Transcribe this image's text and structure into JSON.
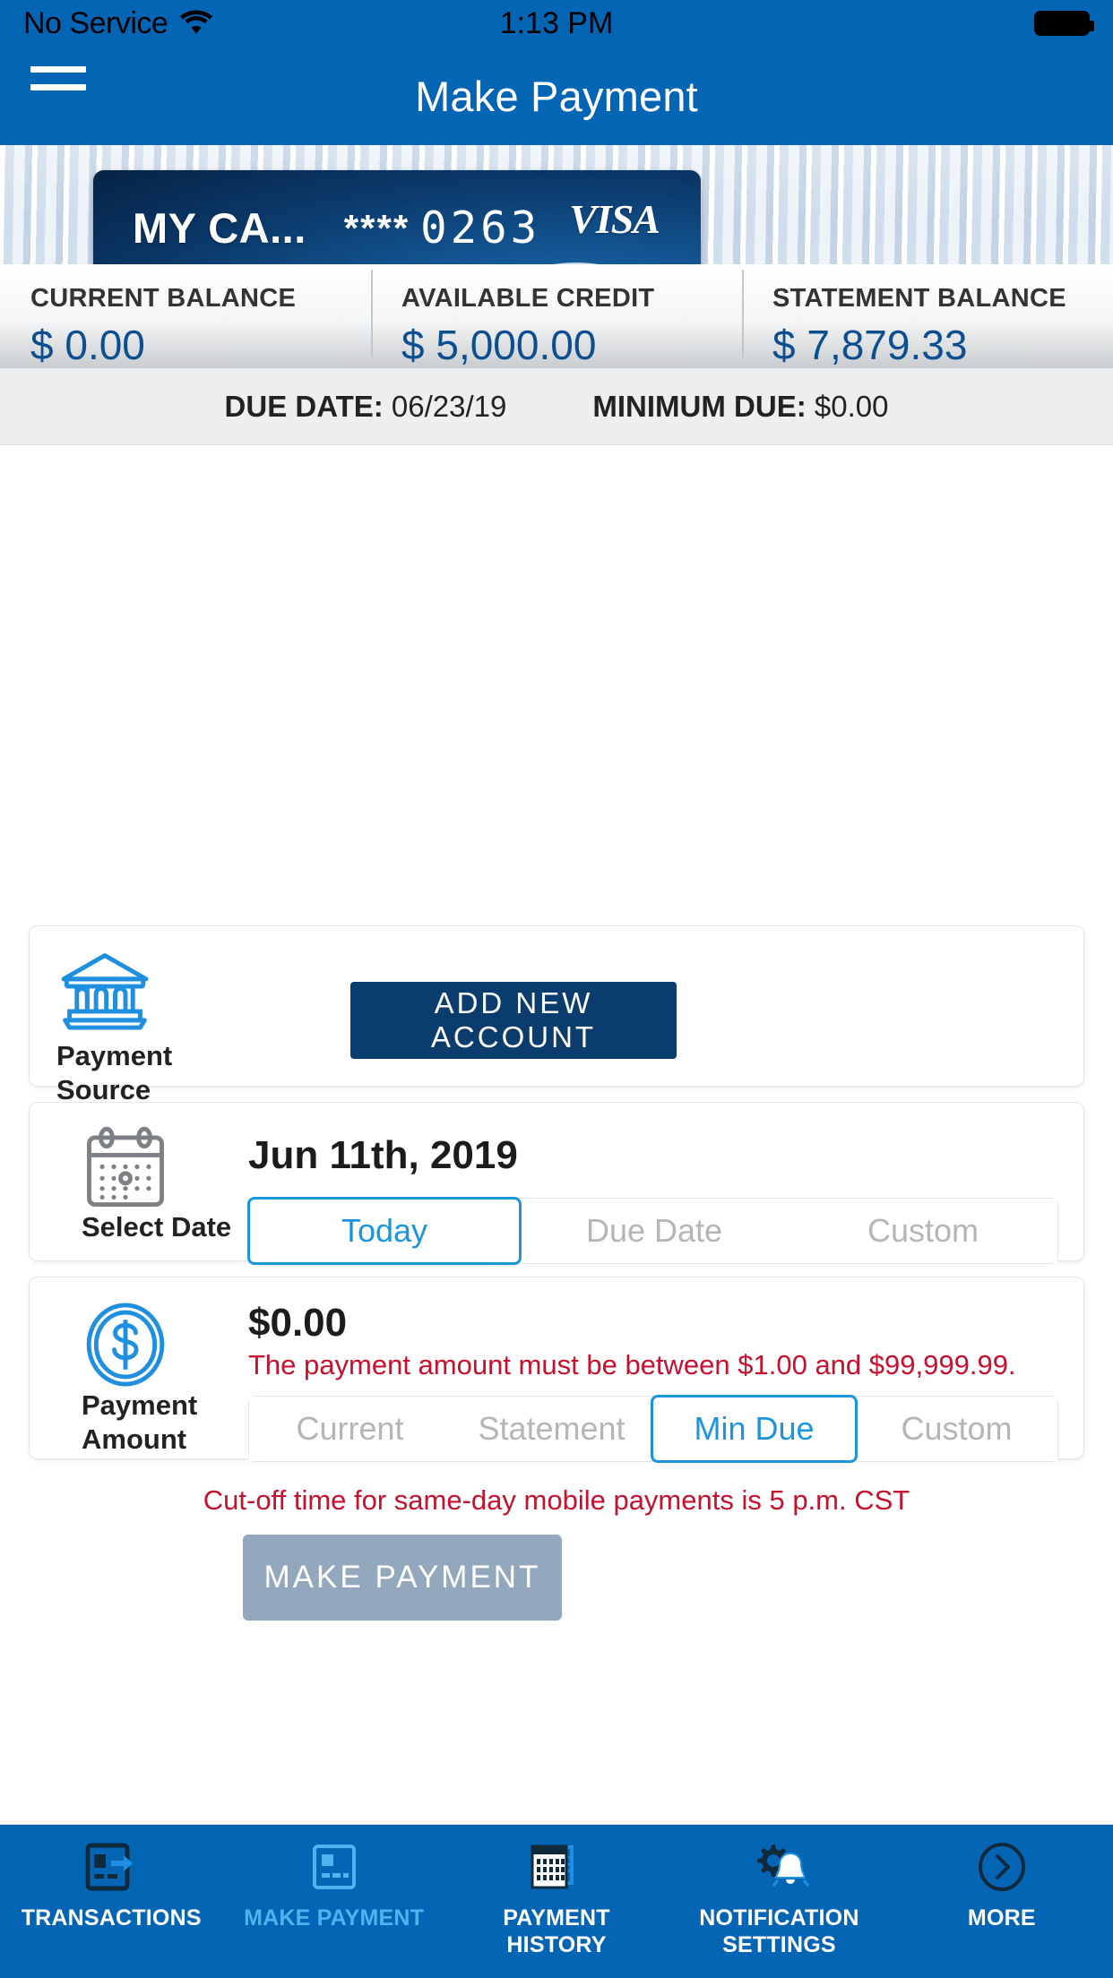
{
  "status_bar": {
    "carrier": "No Service",
    "wifi_icon": "wifi-icon",
    "time": "1:13 PM",
    "battery_icon": "battery-full-icon"
  },
  "nav": {
    "menu_icon": "hamburger-menu-icon",
    "title": "Make Payment"
  },
  "card": {
    "name": "MY CA...",
    "mask": "****",
    "last4": "0263",
    "network": "VISA"
  },
  "balances": [
    {
      "label": "CURRENT BALANCE",
      "value": "$ 0.00"
    },
    {
      "label": "AVAILABLE CREDIT",
      "value": "$ 5,000.00"
    },
    {
      "label": "STATEMENT BALANCE",
      "value": "$ 7,879.33"
    }
  ],
  "due_row": {
    "due_date_label": "DUE DATE:",
    "due_date_value": "06/23/19",
    "minimum_due_label": "MINIMUM DUE:",
    "minimum_due_value": "$0.00"
  },
  "payment_source": {
    "icon": "bank-icon",
    "label": "Payment\nSource",
    "label_line1": "Payment",
    "label_line2": "Source",
    "add_account_button": "ADD NEW ACCOUNT"
  },
  "select_date": {
    "icon": "calendar-icon",
    "label": "Select Date",
    "date_value": "Jun 11th, 2019",
    "options": [
      {
        "label": "Today",
        "selected": true
      },
      {
        "label": "Due Date",
        "selected": false
      },
      {
        "label": "Custom",
        "selected": false
      }
    ]
  },
  "payment_amount": {
    "icon": "dollar-coin-icon",
    "label_line1": "Payment",
    "label_line2": "Amount",
    "amount_value": "$0.00",
    "error_message": "The payment amount must be between $1.00 and $99,999.99.",
    "options": [
      {
        "label": "Current",
        "selected": false
      },
      {
        "label": "Statement",
        "selected": false
      },
      {
        "label": "Min Due",
        "selected": true
      },
      {
        "label": "Custom",
        "selected": false
      }
    ]
  },
  "cutoff_notice": "Cut-off time for same-day mobile payments is 5 p.m. CST",
  "make_payment_button": "MAKE PAYMENT",
  "tab_bar": [
    {
      "icon": "transactions-card-arrow-icon",
      "label_line1": "TRANSACTIONS",
      "label_line2": "",
      "active": false
    },
    {
      "icon": "make-payment-card-icon",
      "label_line1": "MAKE PAYMENT",
      "label_line2": "",
      "active": true
    },
    {
      "icon": "payment-history-calendar-dollar-icon",
      "label_line1": "PAYMENT",
      "label_line2": "HISTORY",
      "active": false
    },
    {
      "icon": "notification-settings-gear-bell-icon",
      "label_line1": "NOTIFICATION",
      "label_line2": "SETTINGS",
      "active": false
    },
    {
      "icon": "more-chevron-circle-icon",
      "label_line1": "MORE",
      "label_line2": "",
      "active": false
    }
  ],
  "colors": {
    "brand_blue": "#0565b5",
    "accent_blue": "#1b96dd",
    "dark_navy": "#0b3c6e",
    "error_red": "#c8102e",
    "disabled_gray": "#93a8bd"
  }
}
